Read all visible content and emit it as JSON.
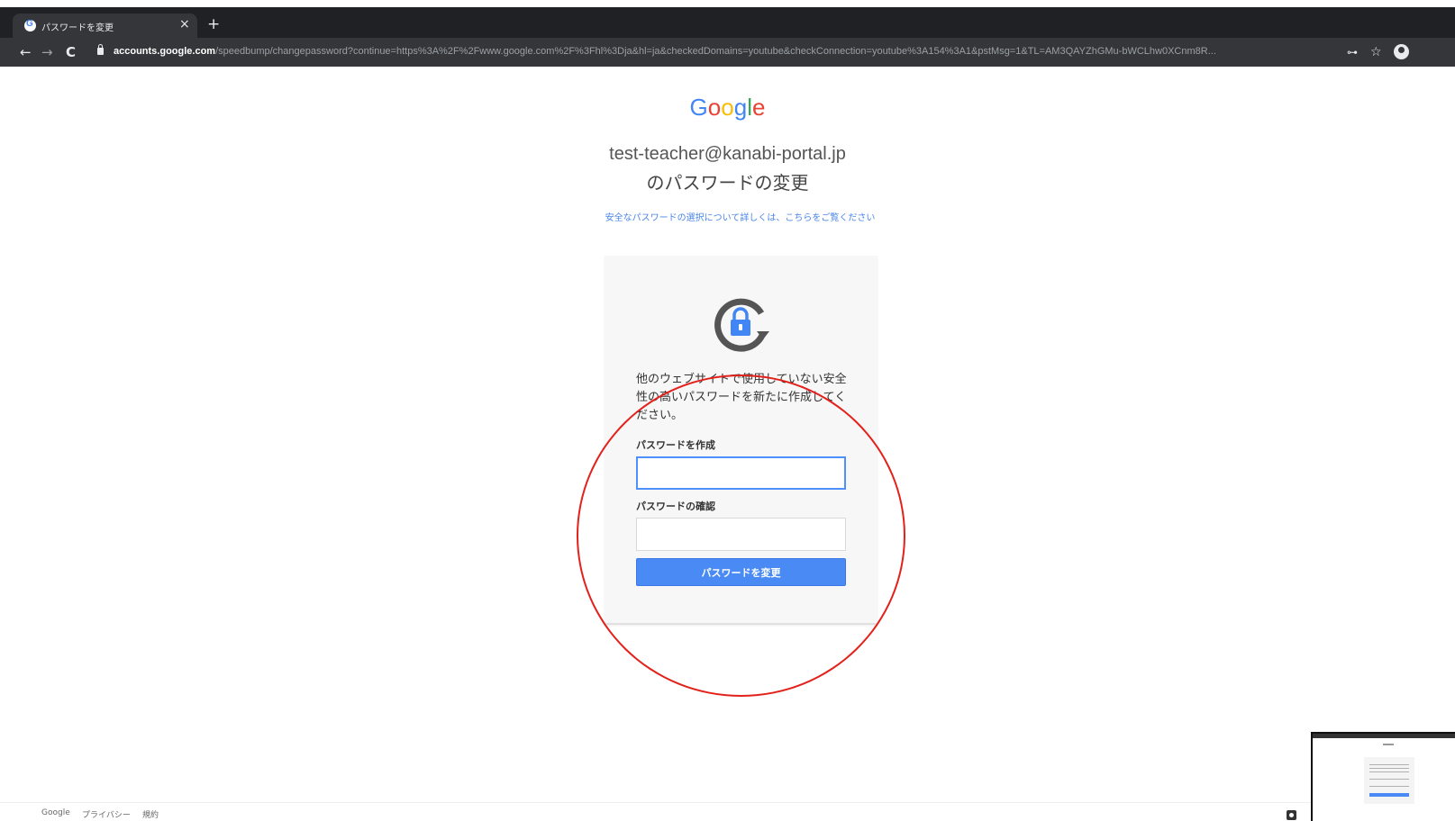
{
  "browser": {
    "tab_title": "パスワードを変更",
    "tab_close": "×",
    "new_tab": "+",
    "url_domain": "accounts.google.com",
    "url_path": "/speedbump/changepassword?continue=https%3A%2F%2Fwww.google.com%2F%3Fhl%3Dja&hl=ja&checkedDomains=youtube&checkConnection=youtube%3A154%3A1&pstMsg=1&TL=AM3QAYZhGMu-bWCLhw0XCnm8R...",
    "back": "←",
    "forward": "→",
    "reload": "C",
    "key": "⊶",
    "star": "☆"
  },
  "page": {
    "logo": [
      "G",
      "o",
      "o",
      "g",
      "l",
      "e"
    ],
    "logo_colors": [
      "#4285f4",
      "#ea4335",
      "#fbbc05",
      "#4285f4",
      "#34a853",
      "#ea4335"
    ],
    "email": "test-teacher@kanabi-portal.jp",
    "heading": "のパスワードの変更",
    "info_link": "安全なパスワードの選択について詳しくは、こちらをご覧ください",
    "description": "他のウェブサイトで使用していない安全性の高いパスワードを新たに作成してください。",
    "create_label": "パスワードを作成",
    "confirm_label": "パスワードの確認",
    "create_value": "",
    "confirm_value": "",
    "submit_label": "パスワードを変更"
  },
  "footer": {
    "google": "Google",
    "privacy": "プライバシー",
    "terms": "規約"
  },
  "colors": {
    "accent": "#4a8af4",
    "annotation": "#e3211b"
  }
}
